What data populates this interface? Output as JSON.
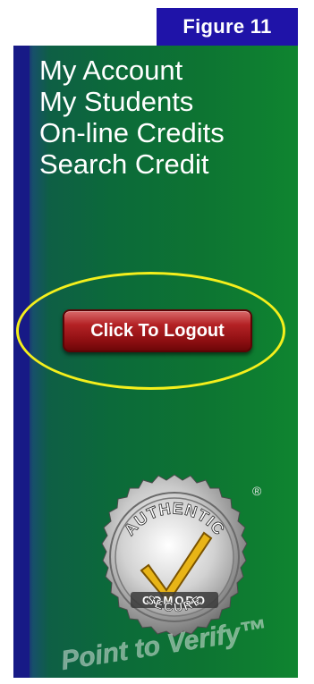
{
  "figure_label": "Figure 11",
  "nav": {
    "items": [
      {
        "label": "My Account"
      },
      {
        "label": "My Students"
      },
      {
        "label": "On-line Credits"
      },
      {
        "label": "Search Credit"
      }
    ]
  },
  "logout": {
    "label": "Click To Logout"
  },
  "seal": {
    "top_text": "AUTHENTIC",
    "brand_text": "COMODO",
    "bottom_text": "SECURE",
    "registered_mark": "®",
    "tagline": "Point to Verify™"
  },
  "colors": {
    "figure_label_bg": "#1f13a8",
    "sidebar_green": "#0d7432",
    "sidebar_blue_edge": "#171a86",
    "highlight_ring": "#f4ef1c",
    "logout_button": "#a8181b"
  }
}
